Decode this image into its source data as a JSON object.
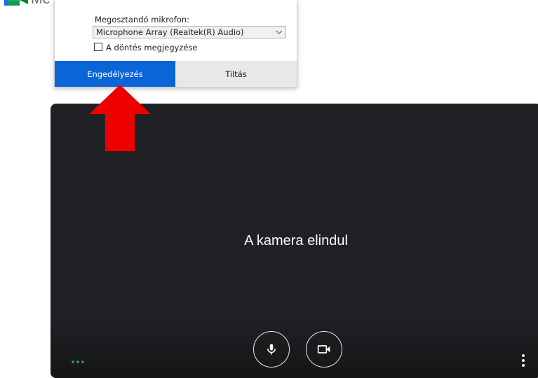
{
  "app": {
    "logo_text": "Me"
  },
  "permission_popup": {
    "mic_label": "Megosztandó mikrofon:",
    "mic_select_value": "Microphone Array (Realtek(R) Audio)",
    "remember_label": "A döntés megjegyzése",
    "remember_checked": false,
    "allow_label": "Engedélyezés",
    "deny_label": "Tiltás"
  },
  "video_preview": {
    "status_text": "A kamera elindul",
    "mic_button_icon": "microphone-icon",
    "camera_button_icon": "video-camera-icon",
    "effects_icon": "three-dots-horizontal-icon",
    "more_icon": "three-dots-vertical-icon"
  },
  "colors": {
    "allow_button": "#0a65d8",
    "deny_button": "#e8e8e8",
    "video_background": "#202124",
    "annotation_arrow": "#ee0000",
    "dots_accent": "#34a853"
  }
}
